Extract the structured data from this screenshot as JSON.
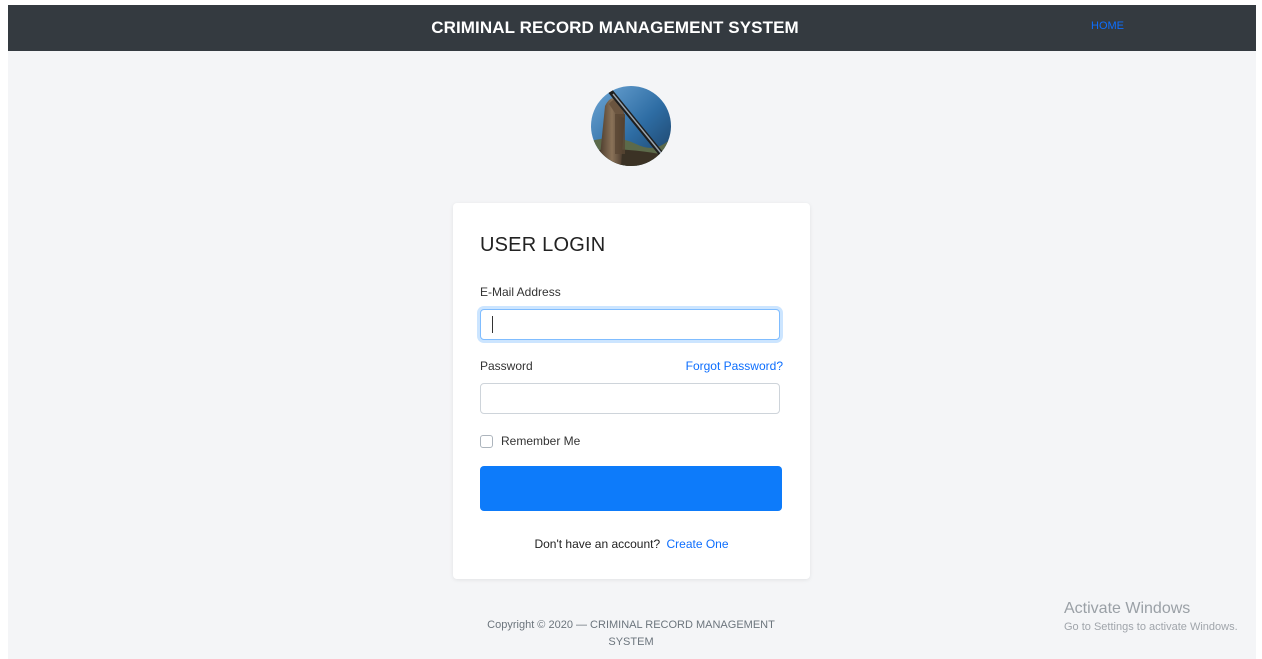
{
  "navbar": {
    "title": "CRIMINAL RECORD MANAGEMENT SYSTEM",
    "home_link": "HOME"
  },
  "avatar": {
    "icon": "justice-statue-logo-icon"
  },
  "login_card": {
    "title": "USER LOGIN",
    "email_label": "E-Mail Address",
    "email_value": "",
    "password_label": "Password",
    "password_value": "",
    "forgot_link": "Forgot Password?",
    "remember_label": "Remember Me",
    "remember_checked": false,
    "login_button_label": "",
    "signup_prompt": "Don't have an account?",
    "signup_link": "Create One"
  },
  "footer": {
    "copyright_line1": "Copyright © 2020 — CRIMINAL RECORD MANAGEMENT",
    "copyright_line2": "SYSTEM"
  },
  "os_watermark": {
    "title": "Activate Windows",
    "subtitle": "Go to Settings to activate Windows."
  },
  "colors": {
    "navbar_bg": "#343a40",
    "accent": "#0d7bfa",
    "page_bg": "#f4f5f7"
  }
}
